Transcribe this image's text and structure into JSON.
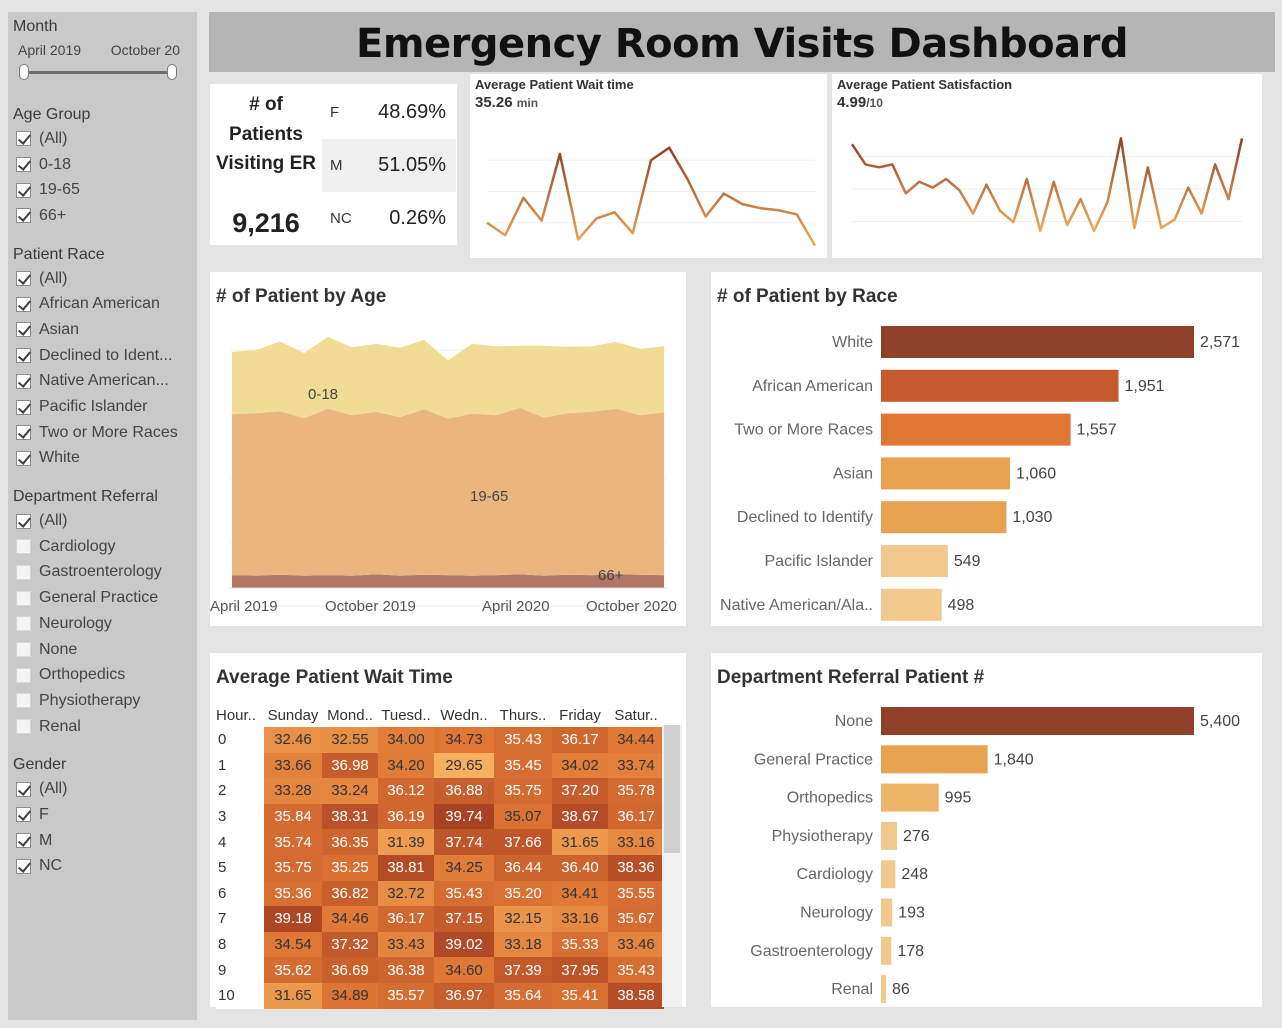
{
  "title": "Emergency Room Visits Dashboard",
  "sidebar": {
    "month": {
      "title": "Month",
      "start": "April 2019",
      "end": "October 20"
    },
    "age_group": {
      "title": "Age Group",
      "items": [
        {
          "label": "(All)",
          "checked": true
        },
        {
          "label": "0-18",
          "checked": true
        },
        {
          "label": "19-65",
          "checked": true
        },
        {
          "label": "66+",
          "checked": true
        }
      ]
    },
    "race": {
      "title": "Patient Race",
      "items": [
        {
          "label": "(All)",
          "checked": true
        },
        {
          "label": "African American",
          "checked": true
        },
        {
          "label": "Asian",
          "checked": true
        },
        {
          "label": "Declined to Ident...",
          "checked": true
        },
        {
          "label": "Native American...",
          "checked": true
        },
        {
          "label": "Pacific Islander",
          "checked": true
        },
        {
          "label": "Two or More Races",
          "checked": true
        },
        {
          "label": "White",
          "checked": true
        }
      ]
    },
    "department": {
      "title": "Department Referral",
      "items": [
        {
          "label": "(All)",
          "checked": true
        },
        {
          "label": "Cardiology",
          "checked": false
        },
        {
          "label": "Gastroenterology",
          "checked": false
        },
        {
          "label": "General Practice",
          "checked": false
        },
        {
          "label": "Neurology",
          "checked": false
        },
        {
          "label": "None",
          "checked": false
        },
        {
          "label": "Orthopedics",
          "checked": false
        },
        {
          "label": "Physiotherapy",
          "checked": false
        },
        {
          "label": "Renal",
          "checked": false
        }
      ]
    },
    "gender": {
      "title": "Gender",
      "items": [
        {
          "label": "(All)",
          "checked": true
        },
        {
          "label": "F",
          "checked": true
        },
        {
          "label": "M",
          "checked": true
        },
        {
          "label": "NC",
          "checked": true
        }
      ]
    }
  },
  "kpi": {
    "label": "# of Patients Visiting ER",
    "total": "9,216",
    "gender": [
      {
        "key": "F",
        "value": "48.69%"
      },
      {
        "key": "M",
        "value": "51.05%"
      },
      {
        "key": "NC",
        "value": "0.26%"
      }
    ]
  },
  "wait_spark": {
    "title": "Average Patient Wait time",
    "value": "35.26",
    "unit": "min"
  },
  "satisfaction_spark": {
    "title": "Average Patient Satisfaction",
    "value": "4.99",
    "unit": "/10"
  },
  "age_chart": {
    "title": "# of Patient by Age",
    "band_labels": [
      "0-18",
      "19-65",
      "66+"
    ],
    "x_labels": [
      "April 2019",
      "October 2019",
      "April 2020",
      "October 2020"
    ]
  },
  "race_chart": {
    "title": "# of Patient by Race"
  },
  "heat": {
    "title": "Average Patient Wait Time",
    "headers": [
      "Hour..",
      "Sunday",
      "Mond..",
      "Tuesd..",
      "Wedn..",
      "Thurs..",
      "Friday",
      "Satur.."
    ]
  },
  "dept_chart": {
    "title": "Department Referral Patient #"
  },
  "colors": {
    "dark": "#8f4028",
    "orange": "#dd7a3c",
    "light": "#f2c98c",
    "area_top": "#f1dc96",
    "area_mid": "#ebb57f",
    "area_bottom": "#b27668"
  },
  "chart_data": [
    {
      "type": "line",
      "title": "Average Patient Wait time",
      "x": [
        1,
        2,
        3,
        4,
        5,
        6,
        7,
        8,
        9,
        10,
        11,
        12,
        13,
        14,
        15,
        16,
        17,
        18,
        19
      ],
      "values": [
        35.0,
        34.4,
        36.2,
        35.1,
        38.3,
        34.2,
        35.2,
        35.5,
        34.5,
        38.0,
        38.6,
        37.1,
        35.3,
        36.4,
        35.9,
        35.7,
        35.6,
        35.4,
        33.9
      ],
      "ylim": [
        33.5,
        39.5
      ]
    },
    {
      "type": "line",
      "title": "Average Patient Satisfaction",
      "x": [
        1,
        2,
        3,
        4,
        5,
        6,
        7,
        8,
        9,
        10,
        11,
        12,
        13,
        14,
        15,
        16,
        17,
        18,
        19,
        20,
        21,
        22,
        23,
        24,
        25,
        26,
        27,
        28,
        29,
        30
      ],
      "values": [
        6.3,
        5.6,
        5.5,
        5.6,
        4.6,
        5.0,
        4.8,
        5.1,
        4.7,
        3.9,
        4.9,
        4.0,
        3.6,
        5.1,
        3.3,
        5.0,
        3.5,
        4.4,
        3.3,
        4.3,
        6.5,
        3.4,
        5.5,
        3.4,
        3.7,
        4.8,
        3.9,
        5.6,
        4.4,
        6.5
      ],
      "ylim": [
        2.5,
        7.0
      ]
    },
    {
      "type": "area",
      "title": "# of Patient by Age",
      "x": [
        "Apr 2019",
        "May 2019",
        "Jun 2019",
        "Jul 2019",
        "Aug 2019",
        "Sep 2019",
        "Oct 2019",
        "Nov 2019",
        "Dec 2019",
        "Jan 2020",
        "Feb 2020",
        "Mar 2020",
        "Apr 2020",
        "May 2020",
        "Jun 2020",
        "Jul 2020",
        "Aug 2020",
        "Sep 2020",
        "Oct 2020"
      ],
      "series": [
        {
          "name": "66+",
          "values": [
            26,
            25,
            27,
            25,
            26,
            25,
            28,
            25,
            27,
            26,
            25,
            26,
            28,
            25,
            27,
            26,
            28,
            27,
            26
          ]
        },
        {
          "name": "19-65",
          "values": [
            327,
            330,
            332,
            320,
            338,
            326,
            330,
            322,
            336,
            318,
            329,
            325,
            338,
            321,
            328,
            332,
            336,
            324,
            331
          ]
        },
        {
          "name": "0-18",
          "values": [
            127,
            128,
            142,
            132,
            146,
            138,
            138,
            141,
            141,
            118,
            142,
            140,
            126,
            146,
            135,
            133,
            136,
            135,
            134
          ]
        }
      ],
      "ylim": [
        0,
        520
      ]
    },
    {
      "type": "bar",
      "title": "# of Patient by Race",
      "categories": [
        "White",
        "African American",
        "Two or More Races",
        "Asian",
        "Declined to Identify",
        "Pacific Islander",
        "Native American/Ala.."
      ],
      "values": [
        2571,
        1951,
        1557,
        1060,
        1030,
        549,
        498
      ],
      "labels": [
        "2,571",
        "1,951",
        "1,557",
        "1,060",
        "1,030",
        "549",
        "498"
      ]
    },
    {
      "type": "bar",
      "title": "Department Referral Patient #",
      "categories": [
        "None",
        "General Practice",
        "Orthopedics",
        "Physiotherapy",
        "Cardiology",
        "Neurology",
        "Gastroenterology",
        "Renal"
      ],
      "values": [
        5400,
        1840,
        995,
        276,
        248,
        193,
        178,
        86
      ],
      "labels": [
        "5,400",
        "1,840",
        "995",
        "276",
        "248",
        "193",
        "178",
        "86"
      ]
    },
    {
      "type": "heatmap",
      "title": "Average Patient Wait Time",
      "columns": [
        "Sunday",
        "Mond..",
        "Tuesd..",
        "Wedn..",
        "Thurs..",
        "Friday",
        "Satur.."
      ],
      "rows": [
        "0",
        "1",
        "2",
        "3",
        "4",
        "5",
        "6",
        "7",
        "8",
        "9",
        "10"
      ],
      "values": [
        [
          "32.46",
          "32.55",
          "34.00",
          "34.73",
          "35.43",
          "36.17",
          "34.44"
        ],
        [
          "33.66",
          "36.98",
          "34.20",
          "29.65",
          "35.45",
          "34.02",
          "33.74"
        ],
        [
          "33.28",
          "33.24",
          "36.12",
          "36.88",
          "35.75",
          "37.20",
          "35.78"
        ],
        [
          "35.84",
          "38.31",
          "36.19",
          "39.74",
          "35.07",
          "38.67",
          "36.17"
        ],
        [
          "35.74",
          "36.35",
          "31.39",
          "37.74",
          "37.66",
          "31.65",
          "33.16"
        ],
        [
          "35.75",
          "35.25",
          "38.81",
          "34.25",
          "36.44",
          "36.40",
          "38.36"
        ],
        [
          "35.36",
          "36.82",
          "32.72",
          "35.43",
          "35.20",
          "34.41",
          "35.55"
        ],
        [
          "39.18",
          "34.46",
          "36.17",
          "37.15",
          "32.15",
          "33.16",
          "35.67"
        ],
        [
          "34.54",
          "37.32",
          "33.43",
          "39.02",
          "33.18",
          "35.33",
          "33.46"
        ],
        [
          "35.62",
          "36.69",
          "36.38",
          "34.60",
          "37.39",
          "37.95",
          "35.43"
        ],
        [
          "31.65",
          "34.89",
          "35.57",
          "36.97",
          "35.64",
          "35.41",
          "38.58"
        ]
      ]
    }
  ]
}
